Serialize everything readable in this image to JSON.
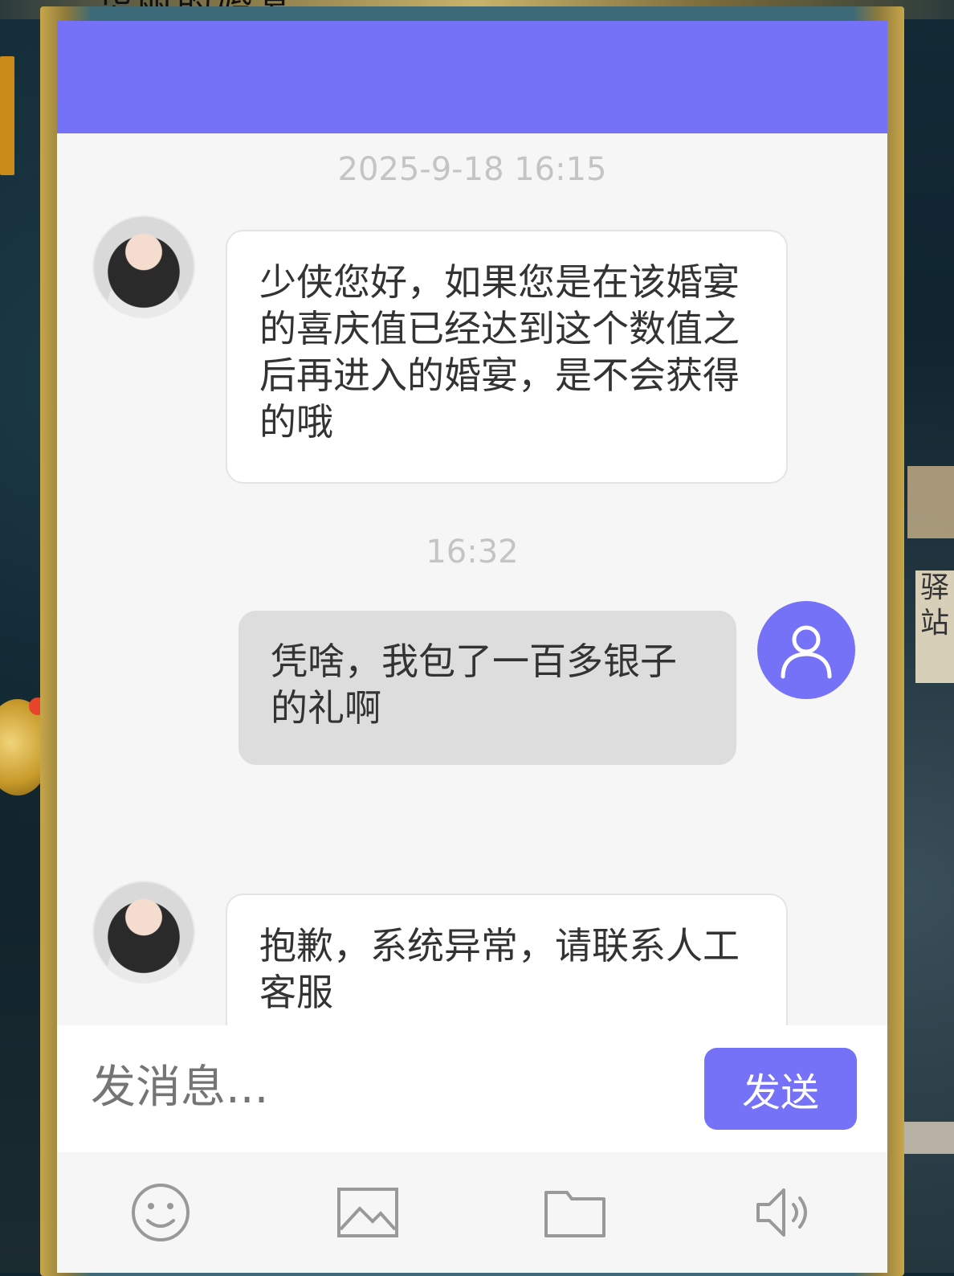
{
  "background": {
    "banner_title": "华丽的婚宴",
    "right_sign": "驿站"
  },
  "chat": {
    "messages": [
      {
        "timestamp": "2025-9-18 16:15",
        "sender": "agent",
        "text": "少侠您好，如果您是在该婚宴的喜庆值已经达到这个数值之后再进入的婚宴，是不会获得的哦"
      },
      {
        "timestamp": "16:32",
        "sender": "user",
        "text": "凭啥，我包了一百多银子的礼啊"
      },
      {
        "timestamp": "",
        "sender": "agent",
        "text": "抱歉，系统异常，请联系人工客服"
      }
    ]
  },
  "composer": {
    "placeholder": "发消息...",
    "send_label": "发送"
  },
  "toolbar": {
    "icons": [
      "emoji-icon",
      "image-icon",
      "folder-icon",
      "speaker-icon"
    ]
  },
  "colors": {
    "accent": "#7572f7",
    "bubble_user": "#dddddd",
    "bubble_agent": "#ffffff",
    "timestamp": "#c4c4c4"
  }
}
